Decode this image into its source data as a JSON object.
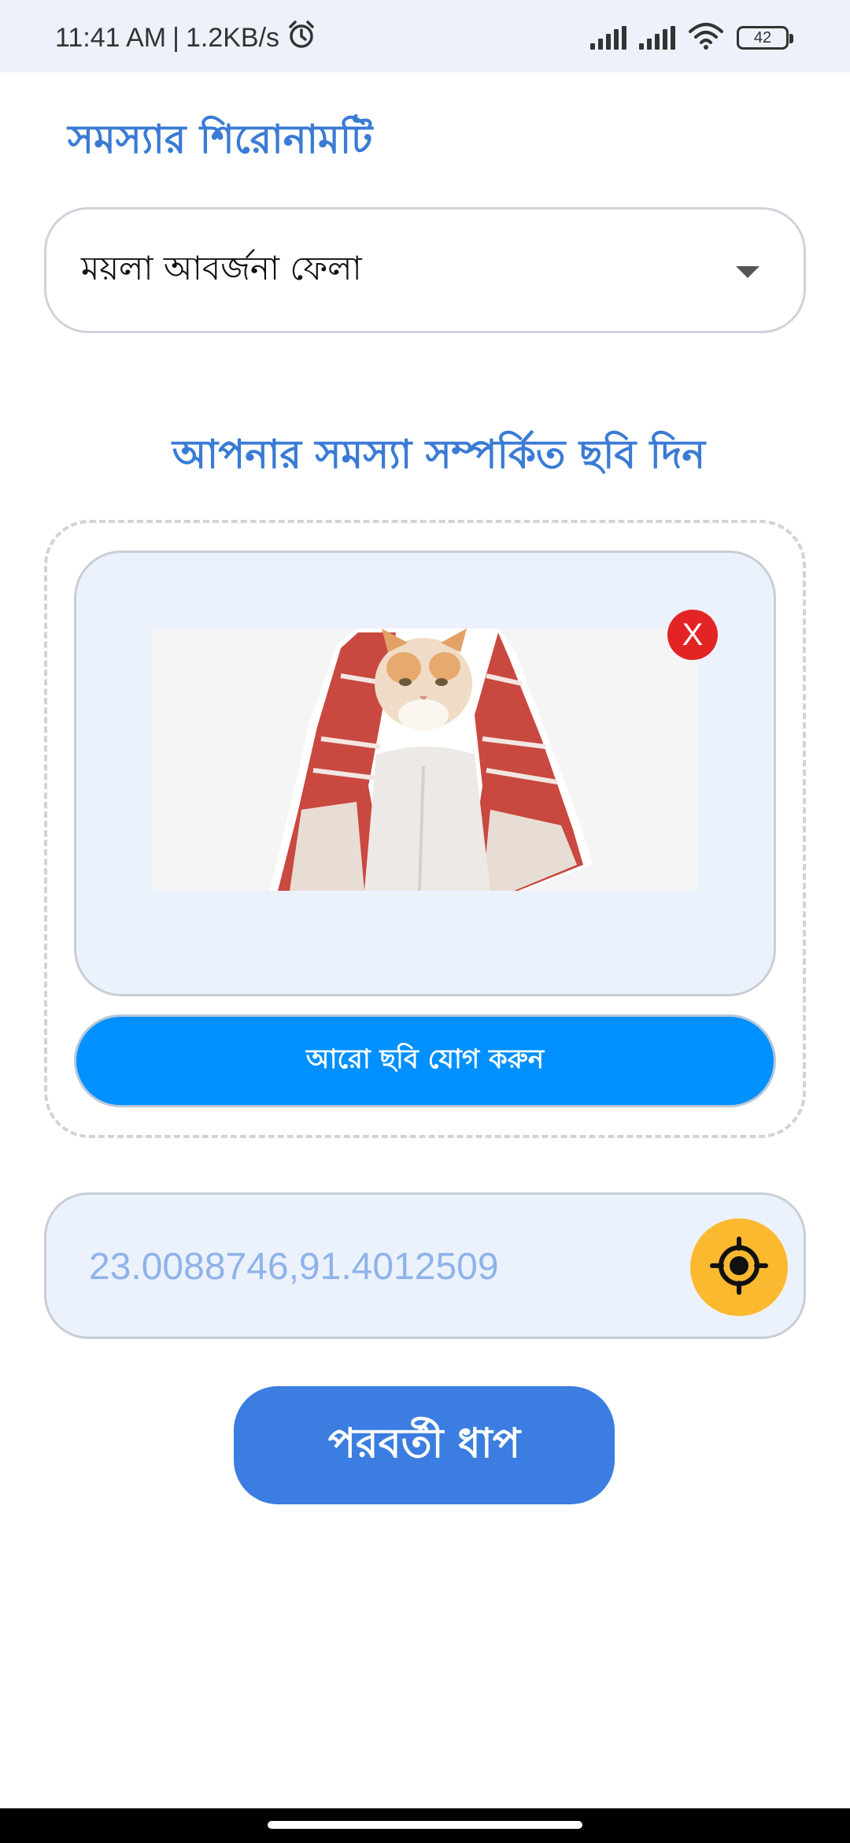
{
  "status_bar": {
    "time": "11:41 AM",
    "separator": "|",
    "net_speed": "1.2KB/s",
    "battery_level": "42"
  },
  "form": {
    "title_label": "সমস্যার শিরোনামটি",
    "title_value": "ময়লা আবর্জনা ফেলা",
    "photo_heading": "আপনার সমস্যা সম্পর্কিত ছবি দিন",
    "remove_label": "X",
    "add_more_label": "আরো ছবি যোগ করুন",
    "location_value": "23.0088746,91.4012509",
    "next_label": "পরবর্তী ধাপ"
  },
  "colors": {
    "accent": "#3a7bd5",
    "primary_button": "#0090ff",
    "next_button": "#3b7de0",
    "locate_button": "#fbb930",
    "remove_button": "#e32424",
    "field_background": "#ecf2fc"
  },
  "icons": {
    "alarm": "alarm-clock-icon",
    "signal": "cellular-signal-icon",
    "wifi": "wifi-icon",
    "battery": "battery-icon",
    "dropdown": "caret-down-icon",
    "locate": "crosshair-locate-icon",
    "remove": "close-icon"
  }
}
